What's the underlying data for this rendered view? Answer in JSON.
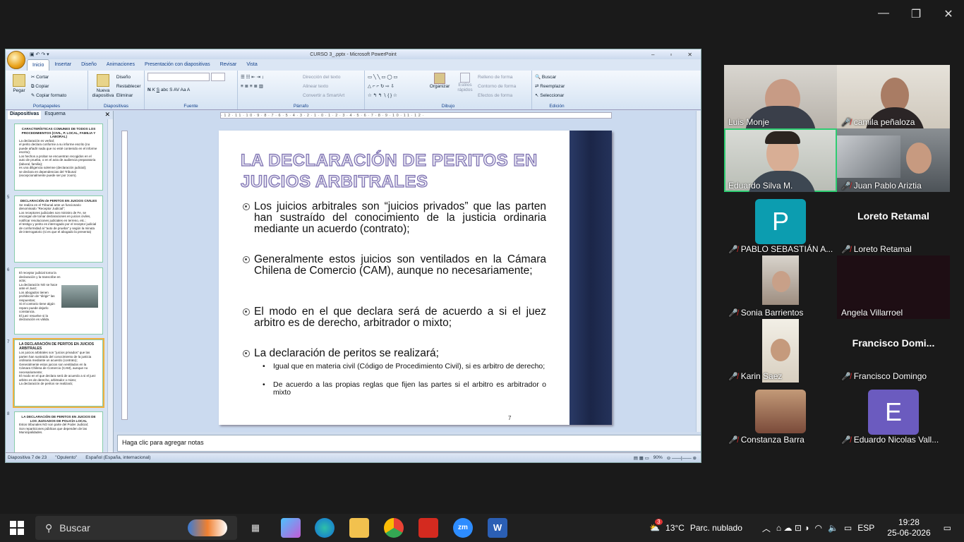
{
  "zoom": {
    "controls": [
      "—",
      "❐",
      "✕"
    ]
  },
  "ppt": {
    "title": "CURSO 3_.pptx - Microsoft PowerPoint",
    "tabs": [
      "Inicio",
      "Insertar",
      "Diseño",
      "Animaciones",
      "Presentación con diapositivas",
      "Revisar",
      "Vista"
    ],
    "groups": {
      "portapapeles": {
        "label": "Portapapeles",
        "pegar": "Pegar",
        "cortar": "Cortar",
        "copiar": "Copiar",
        "copiar_formato": "Copiar formato"
      },
      "diapositivas": {
        "label": "Diapositivas",
        "nueva": "Nueva diapositiva",
        "diseno": "Diseño",
        "restablecer": "Restablecer",
        "eliminar": "Eliminar"
      },
      "fuente": {
        "label": "Fuente"
      },
      "parrafo": {
        "label": "Párrafo",
        "direccion": "Dirección del texto",
        "alinear": "Alinear texto",
        "smartart": "Convertir a SmartArt"
      },
      "dibujo": {
        "label": "Dibujo",
        "organizar": "Organizar",
        "estilos": "Estilos rápidos",
        "relleno": "Relleno de forma",
        "contorno": "Contorno de forma",
        "efectos": "Efectos de forma"
      },
      "edicion": {
        "label": "Edición",
        "buscar": "Buscar",
        "reemplazar": "Reemplazar",
        "seleccionar": "Seleccionar"
      }
    },
    "pane_tabs": [
      "Diapositivas",
      "Esquema"
    ],
    "thumbs": [
      {
        "num": "",
        "title": "CARACTERÍSTICAS COMUNES DE TODOS LOS PROCEDIMIENTOS (CIVIL, P. LOCAL, FAMILIA Y LABORAL)",
        "lines": [
          "La declaración es verbal;",
          "el perito declara conforme a su informe escrito (no puede añadir nada que no esté contenido en el informe escrito);",
          "Los hechos a probar se encuentran recogidos en el auto de prueba, o en el acta de audiencia preparatoria (laboral, familia);",
          "es una diligencia solemne (declaración judicial);",
          "se declara en dependencias del Tribunal (excepcionalmente puede ser por zoom)."
        ]
      },
      {
        "num": "5",
        "title": "DECLARACIÓN de PERITOS EN JUICIOS CIVILES",
        "lines": [
          "Se realiza en el Tribunal ante un funcionario denominado \"Receptor Judicial\";",
          "Los receptores judiciales son ministro de Fe, se encargan de tomar declaraciones en juicios civiles, notificar resoluciones judiciales en terreno, etc.;",
          "el testigo y perito es interrogado por el receptor judicial de conformidad al \"auto de prueba\" y según la minuta de interrogatorio (si es que el abogado la presenta)"
        ]
      },
      {
        "num": "6",
        "title": "",
        "lines": [
          "El receptor judicial toma la declaración y la transcribe en acta;",
          "La declaración NO se hace ante el Juez;",
          "Los abogados tienen prohibición de \"dirigir\" las respuestas;",
          "Si el contrario tiene algún reparo puede dejarlo constancia.",
          "El juez resuelve si la declaración es válida."
        ]
      },
      {
        "num": "7",
        "title": "LA DECLARACIÓN DE PERITOS EN JUICIOS ARBITRALES",
        "lines": [
          "Los juicios arbitrales son \"juicios privados\" que las parten han sustraído del conocimiento de la justicia ordinaria mediante un acuerdo (contrato);",
          "Generalmente estos juicios son ventilados en la Cámara Chilena de Comercio (CAM), aunque no necesariamente;",
          "El modo en el que declara será de acuerdo a si el juez arbitro es de derecho, arbitrador o mixto;",
          "La declaración de peritos se realizará;"
        ]
      },
      {
        "num": "8",
        "title": "LA DECLARACIÓN DE PERITOS EN JUICIOS DE LOS JUZGADOS DE POLICÍA LOCAL",
        "lines": [
          "Estos tribunales NO son parte del Poder Judicial;",
          "Son reparticiones públicas que dependen de las Municipalidades."
        ]
      }
    ],
    "slide": {
      "title": "LA DECLARACIÓN DE PERITOS EN JUICIOS ARBITRALES",
      "bullets": [
        "Los juicios arbitrales son “juicios privados” que las parten han sustraído del conocimiento de la justicia ordinaria mediante un acuerdo (contrato);",
        "Generalmente estos juicios son ventilados en la Cámara Chilena de Comercio (CAM), aunque no necesariamente;",
        "El modo en el que declara será de acuerdo a si el juez arbitro es de derecho, arbitrador o mixto;",
        "La declaración de peritos se realizará;"
      ],
      "subbullets": [
        "Igual que en materia civil (Código de Procedimiento Civil), si es arbitro de derecho;",
        "De acuerdo a las propias reglas que fijen las partes si el arbitro es arbitrador o mixto"
      ],
      "page": "7"
    },
    "notes_placeholder": "Haga clic para agregar notas",
    "status": {
      "slide": "Diapositiva 7 de 23",
      "theme": "\"Opulento\"",
      "lang": "Español (España, internacional)",
      "zoom": "90%"
    }
  },
  "participants": [
    {
      "name": "Luis Monje",
      "muted": false
    },
    {
      "name": "camila peñaloza",
      "muted": true
    },
    {
      "name": "Eduardo Silva M.",
      "muted": false
    },
    {
      "name": "Juan Pablo Ariztia",
      "muted": true
    },
    {
      "name": "PABLO SEBASTIÁN A...",
      "muted": true,
      "avatar": "P"
    },
    {
      "name": "Loreto Retamal",
      "muted": true,
      "display": "Loreto Retamal"
    },
    {
      "name": "Sonia Barrientos",
      "muted": true
    },
    {
      "name": "Angela Villarroel",
      "muted": false
    },
    {
      "name": "Karin Saez",
      "muted": true
    },
    {
      "name": "Francisco Domingo",
      "muted": true,
      "display": "Francisco  Domi..."
    },
    {
      "name": "Constanza Barra",
      "muted": true
    },
    {
      "name": "Eduardo Nicolas Vall...",
      "muted": true,
      "avatar": "E"
    }
  ],
  "taskbar": {
    "search": "Buscar",
    "weather_temp": "13°C",
    "weather_text": "Parc. nublado",
    "lang": "ESP",
    "time": "19:28",
    "date": "25-06-2026",
    "weather_badge": "3"
  }
}
